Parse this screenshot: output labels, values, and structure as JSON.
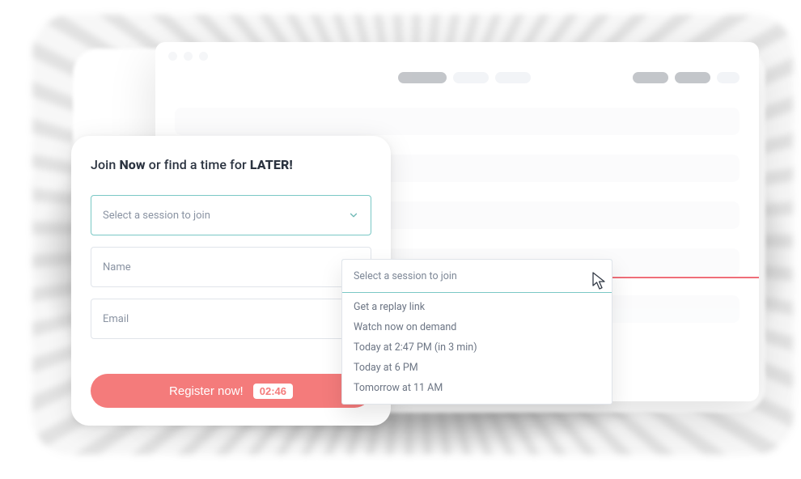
{
  "form": {
    "title_prefix": "Join ",
    "title_now": "Now",
    "title_middle": " or find a time for ",
    "title_later": "LATER!",
    "session_placeholder": "Select a session to join",
    "name_placeholder": "Name",
    "email_placeholder": "Email",
    "register_label": "Register now!",
    "countdown": "02:46"
  },
  "dropdown": {
    "header": "Select a session to join",
    "items": [
      "Get a replay link",
      "Watch now on demand",
      "Today at 2:47 PM (in 3 min)",
      "Today at 6 PM",
      "Tomorrow at 11 AM"
    ]
  },
  "colors": {
    "accent_teal": "#7ac8c5",
    "accent_coral": "#f47b7b",
    "text_dark": "#2b3340"
  }
}
